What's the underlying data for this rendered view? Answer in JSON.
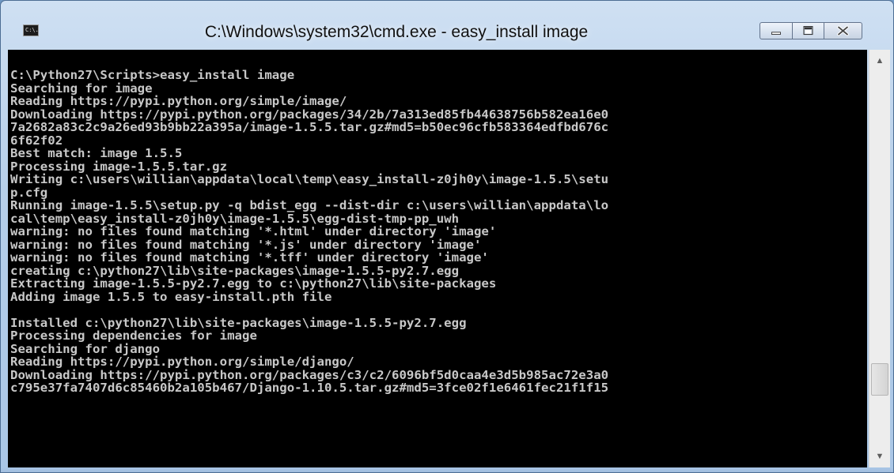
{
  "window": {
    "title": "C:\\Windows\\system32\\cmd.exe - easy_install  image",
    "icon": "console-icon",
    "icon_label": "C:\\.",
    "controls": [
      "minimize-icon",
      "maximize-icon",
      "close-icon"
    ]
  },
  "console": {
    "background": "#000000",
    "text_color": "#c0c0c0",
    "lines": [
      "C:\\Python27\\Scripts>easy_install image",
      "Searching for image",
      "Reading https://pypi.python.org/simple/image/",
      "Downloading https://pypi.python.org/packages/34/2b/7a313ed85fb44638756b582ea16e0",
      "7a2682a83c2c9a26ed93b9bb22a395a/image-1.5.5.tar.gz#md5=b50ec96cfb583364edfbd676c",
      "6f62f02",
      "Best match: image 1.5.5",
      "Processing image-1.5.5.tar.gz",
      "Writing c:\\users\\willian\\appdata\\local\\temp\\easy_install-z0jh0y\\image-1.5.5\\setu",
      "p.cfg",
      "Running image-1.5.5\\setup.py -q bdist_egg --dist-dir c:\\users\\willian\\appdata\\lo",
      "cal\\temp\\easy_install-z0jh0y\\image-1.5.5\\egg-dist-tmp-pp_uwh",
      "warning: no files found matching '*.html' under directory 'image'",
      "warning: no files found matching '*.js' under directory 'image'",
      "warning: no files found matching '*.tff' under directory 'image'",
      "creating c:\\python27\\lib\\site-packages\\image-1.5.5-py2.7.egg",
      "Extracting image-1.5.5-py2.7.egg to c:\\python27\\lib\\site-packages",
      "Adding image 1.5.5 to easy-install.pth file",
      "",
      "Installed c:\\python27\\lib\\site-packages\\image-1.5.5-py2.7.egg",
      "Processing dependencies for image",
      "Searching for django",
      "Reading https://pypi.python.org/simple/django/",
      "Downloading https://pypi.python.org/packages/c3/c2/6096bf5d0caa4e3d5b985ac72e3a0",
      "c795e37fa7407d6c85460b2a105b467/Django-1.10.5.tar.gz#md5=3fce02f1e6461fec21f1f15"
    ]
  },
  "scrollbar": {
    "up_icon": "scroll-up-arrow-icon",
    "down_icon": "scroll-down-arrow-icon",
    "position": 0.85
  }
}
